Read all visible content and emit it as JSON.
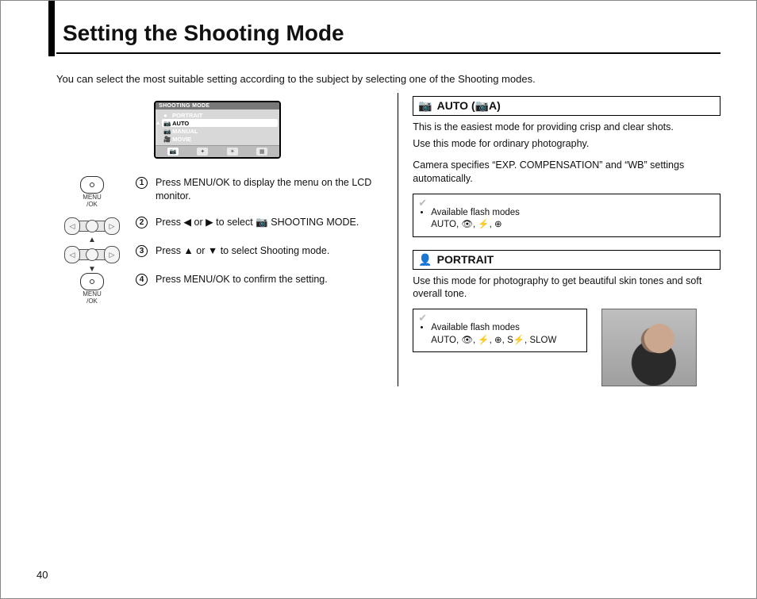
{
  "page_number": "40",
  "title": "Setting the Shooting Mode",
  "intro": "You can select the most suitable setting according to the subject by selecting one of the Shooting modes.",
  "lcd": {
    "header": "SHOOTING MODE",
    "items": [
      {
        "icon": "●",
        "label": "PORTRAIT",
        "selected": false
      },
      {
        "icon": "📷",
        "label": "AUTO",
        "selected": true
      },
      {
        "icon": "📷",
        "label": "MANUAL",
        "selected": false
      },
      {
        "icon": "🎥",
        "label": "MOVIE",
        "selected": false
      }
    ],
    "tabs": [
      "📷",
      "✦",
      "☀",
      "▦"
    ]
  },
  "menuok_label_top": "MENU",
  "menuok_label_bot": "/OK",
  "steps": [
    {
      "n": "1",
      "text": "Press MENU/OK to display the menu on the LCD monitor."
    },
    {
      "n": "2",
      "text": "Press ◀ or ▶ to select 📷 SHOOTING MODE."
    },
    {
      "n": "3",
      "text": "Press ▲ or ▼ to select Shooting mode."
    },
    {
      "n": "4",
      "text": "Press MENU/OK to confirm the setting."
    }
  ],
  "auto": {
    "heading_icon": "📷",
    "heading": "AUTO (📷A)",
    "desc1": "This is the easiest mode for providing crisp and clear shots.",
    "desc2": "Use this mode for ordinary photography.",
    "desc3": "Camera specifies “EXP. COMPENSATION” and “WB” settings automatically.",
    "note_title": "Available flash modes",
    "note_modes": "AUTO, 👁, ⚡, ⊕"
  },
  "portrait": {
    "heading_icon": "👤",
    "heading": "PORTRAIT",
    "desc": "Use this mode for photography to get beautiful skin tones and soft overall tone.",
    "note_title": "Available flash modes",
    "note_modes": "AUTO, 👁, ⚡, ⊕, S⚡, SLOW"
  }
}
